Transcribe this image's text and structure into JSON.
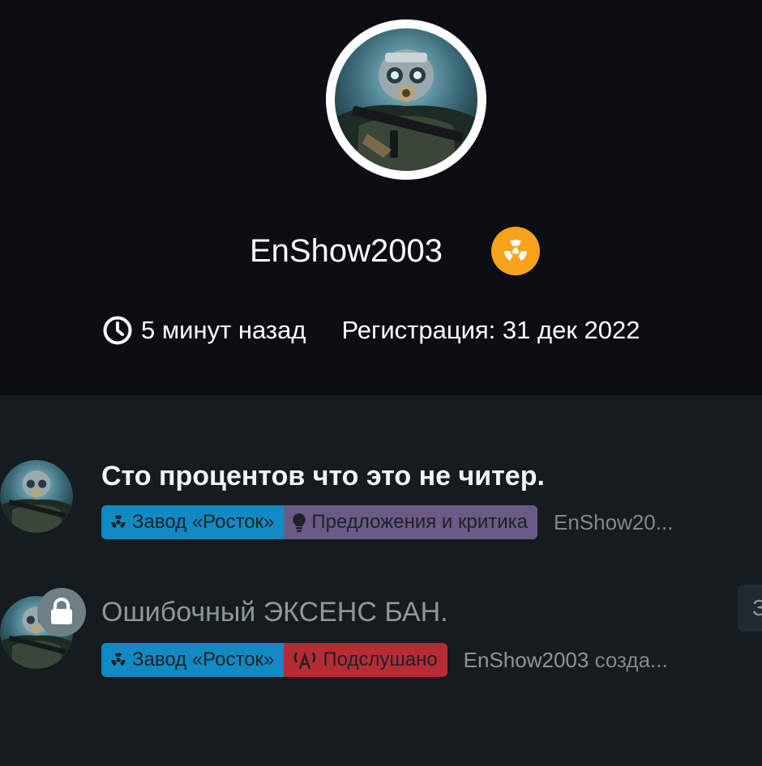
{
  "profile": {
    "username": "EnShow2003",
    "avatar_icon": "stalker-avatar",
    "group_badge_icon": "radiation-icon",
    "group_badge_color": "#f7a21b",
    "last_seen": "5 минут назад",
    "registered": "Регистрация: 31 дек 2022"
  },
  "topics": [
    {
      "title": "Сто процентов что это не читер.",
      "locked": false,
      "tags": [
        {
          "label": "Завод «Росток»",
          "icon": "radiation-icon",
          "color": "#1189c3"
        },
        {
          "label": "Предложения и критика",
          "icon": "lightbulb-icon",
          "color": "#6b5a85"
        }
      ],
      "author_text": "EnShow20..."
    },
    {
      "title": "Ошибочный ЭКСЕНС БАН.",
      "locked": true,
      "tags": [
        {
          "label": "Завод «Росток»",
          "icon": "radiation-icon",
          "color": "#1189c3"
        },
        {
          "label": "Подслушано",
          "icon": "antenna-icon",
          "color": "#b72b35"
        }
      ],
      "author_name": "EnShow2003",
      "author_action": "созда...",
      "side_chip": "З"
    }
  ]
}
